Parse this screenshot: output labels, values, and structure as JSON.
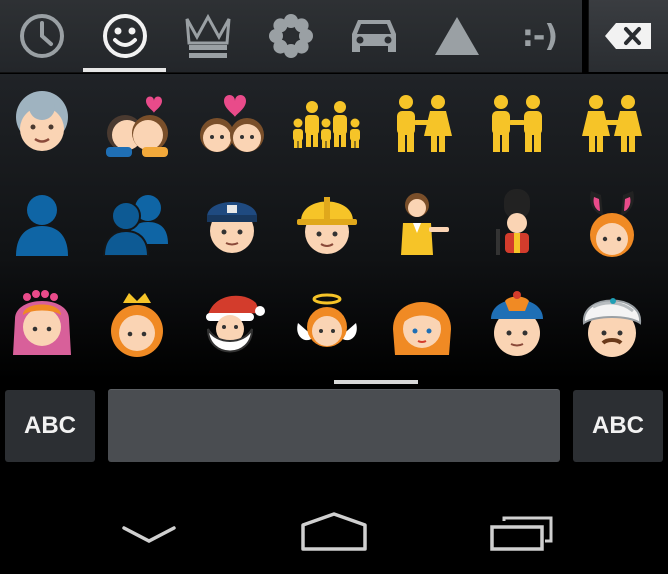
{
  "tabs": [
    {
      "icon": "clock-recent-icon",
      "active": false
    },
    {
      "icon": "smiley-icon",
      "active": true
    },
    {
      "icon": "crown-icon",
      "active": false
    },
    {
      "icon": "flower-icon",
      "active": false
    },
    {
      "icon": "car-icon",
      "active": false
    },
    {
      "icon": "triangle-symbols-icon",
      "active": false
    },
    {
      "icon": "emoticon-text-icon",
      "label": ":-)",
      "active": false
    }
  ],
  "delete_icon": "backspace-icon",
  "emoji_rows": [
    [
      "older-woman",
      "kiss",
      "couple-with-heart",
      "family",
      "man-and-woman-holding-hands",
      "two-men-holding-hands",
      "two-women-holding-hands"
    ],
    [
      "bust-in-silhouette",
      "busts-in-silhouette",
      "police-officer",
      "construction-worker",
      "information-desk-person",
      "guardsman",
      "woman-with-bunny-ears"
    ],
    [
      "bride-with-veil",
      "princess",
      "santa-claus",
      "baby-angel",
      "person-with-blond-hair",
      "man-with-gua-pi-mao",
      "man-with-turban"
    ]
  ],
  "bottom_bar": {
    "left_key": "ABC",
    "right_key": "ABC"
  },
  "nav": {
    "back_icon": "back-chevron-icon",
    "home_icon": "home-icon",
    "recents_icon": "recent-apps-icon"
  },
  "colors": {
    "accent": "#e6e6e6",
    "tab_icon": "#9aa0a4",
    "emoji_yellow": "#f6c428",
    "silhouette_blue": "#0f65a5"
  }
}
